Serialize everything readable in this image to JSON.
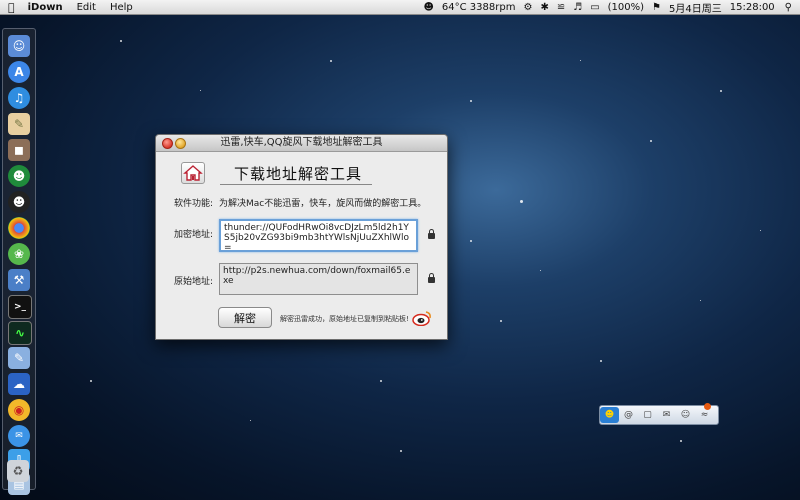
{
  "menubar": {
    "apple": "",
    "app_name": "iDown",
    "menu_edit": "Edit",
    "menu_help": "Help",
    "temp": "64°C 3388rpm",
    "battery": "(100%)",
    "date": "5月4日周三",
    "time": "15:28:00"
  },
  "window": {
    "title": "迅雷,快车,QQ旋风下载地址解密工具",
    "heading": "下载地址解密工具",
    "feature_label": "软件功能:",
    "feature_desc": "为解决Mac不能迅雷，快车，旋风而做的解密工具。",
    "encoded_label": "加密地址:",
    "encoded_value": "thunder://QUFodHRwOi8vcDJzLm5ld2h1YS5jb20vZG93bi9mb3htYWlsNjUuZXhlWlo=",
    "decoded_label": "原始地址:",
    "decoded_value": "http://p2s.newhua.com/down/foxmail65.exe",
    "decode_button": "解密",
    "status": "解密迅雷成功，原始地址已复制到粘贴板!"
  },
  "colors": {
    "accent_focus": "#6aa0d8",
    "desktop_bg": "#0f2646"
  }
}
